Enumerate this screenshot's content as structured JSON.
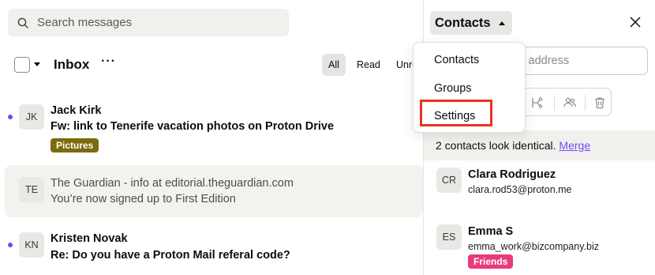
{
  "search": {
    "placeholder": "Search messages",
    "icon": "search-icon"
  },
  "toolbar": {
    "folder": "Inbox",
    "more": "···",
    "filters": [
      {
        "label": "All",
        "active": true
      },
      {
        "label": "Read",
        "active": false
      },
      {
        "label": "Unre",
        "active": false
      }
    ]
  },
  "messages": [
    {
      "initials": "JK",
      "from": "Jack Kirk",
      "subject": "Fw: link to Tenerife vacation photos on Proton Drive",
      "unread": true,
      "label": "Pictures",
      "label_color": "#7c6b0a"
    },
    {
      "initials": "TE",
      "from": "The Guardian - info at editorial.theguardian.com",
      "subject": "You’re now signed up to First Edition",
      "unread": false,
      "selected": true
    },
    {
      "initials": "KN",
      "from": "Kristen Novak",
      "subject": "Re: Do you have a Proton Mail referal code?",
      "unread": true
    }
  ],
  "contacts_panel": {
    "title": "Contacts",
    "email_placeholder": "ail address",
    "notice_text": "2 contacts look identical.",
    "notice_link": "Merge",
    "contacts": [
      {
        "initials": "CR",
        "name": "Clara Rodriguez",
        "email": "clara.rod53@proton.me"
      },
      {
        "initials": "ES",
        "name": "Emma S",
        "email": "emma_work@bizcompany.biz",
        "group": "Friends",
        "group_color": "#e83b7a"
      }
    ]
  },
  "dropdown": {
    "items": [
      "Contacts",
      "Groups",
      "Settings"
    ],
    "highlighted": "Settings"
  },
  "colors": {
    "accent": "#6d4aff",
    "highlight_border": "#ea3323"
  }
}
